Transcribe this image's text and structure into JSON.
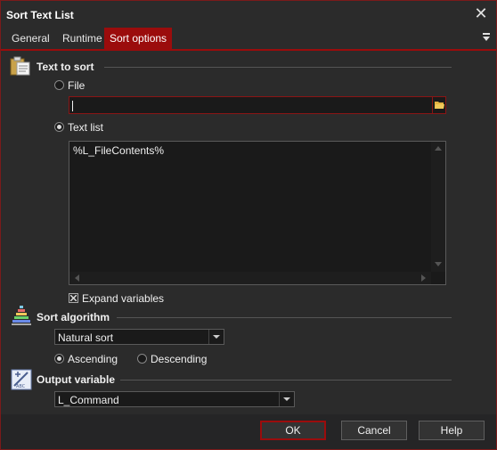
{
  "window": {
    "title": "Sort Text List",
    "close_glyph": "✕"
  },
  "tabs": [
    {
      "label": "General"
    },
    {
      "label": "Runtime"
    },
    {
      "label": "Sort options"
    }
  ],
  "text_to_sort": {
    "title": "Text to sort",
    "file_label": "File",
    "file_value": "",
    "text_list_label": "Text list",
    "text_list_value": "%L_FileContents%",
    "expand_label": "Expand variables",
    "expand_checked": true
  },
  "sort_algorithm": {
    "title": "Sort algorithm",
    "selected": "Natural sort",
    "ascending_label": "Ascending",
    "descending_label": "Descending",
    "order": "Ascending"
  },
  "output_variable": {
    "title": "Output variable",
    "selected": "L_Command"
  },
  "footer": {
    "ok_label": "OK",
    "cancel_label": "Cancel",
    "help_label": "Help"
  },
  "colors": {
    "accent": "#9b0c0c",
    "background": "#2b2b2b"
  }
}
